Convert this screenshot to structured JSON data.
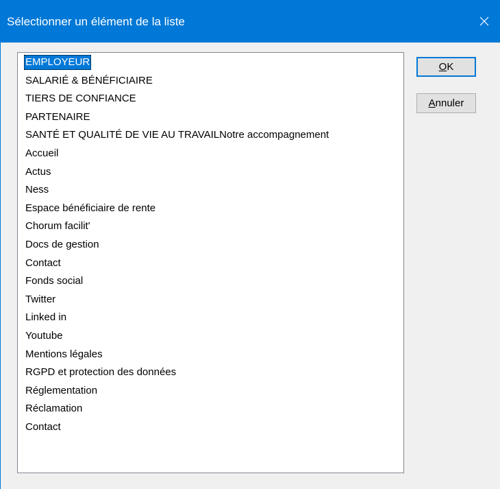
{
  "window": {
    "title": "Sélectionner un élément de la liste"
  },
  "list": {
    "selected_index": 0,
    "items": [
      "EMPLOYEUR",
      "SALARIÉ & BÉNÉFICIAIRE",
      "TIERS DE CONFIANCE",
      "PARTENAIRE",
      "SANTÉ ET QUALITÉ DE VIE AU TRAVAILNotre accompagnement",
      "Accueil",
      "Actus",
      "Ness",
      "Espace bénéficiaire de rente",
      "Chorum facilit'",
      "Docs de gestion",
      "Contact",
      "Fonds social",
      "Twitter",
      "Linked in",
      "Youtube",
      "Mentions légales",
      "RGPD et protection des données",
      "Réglementation",
      "Réclamation",
      "Contact"
    ]
  },
  "buttons": {
    "ok": {
      "accel": "O",
      "rest": "K"
    },
    "cancel": {
      "accel": "A",
      "rest": "nnuler"
    }
  },
  "colors": {
    "titlebar": "#0078d7",
    "selection": "#0078d7",
    "dialog_bg": "#f0f0f0"
  },
  "icons": {
    "close": "close-icon"
  }
}
